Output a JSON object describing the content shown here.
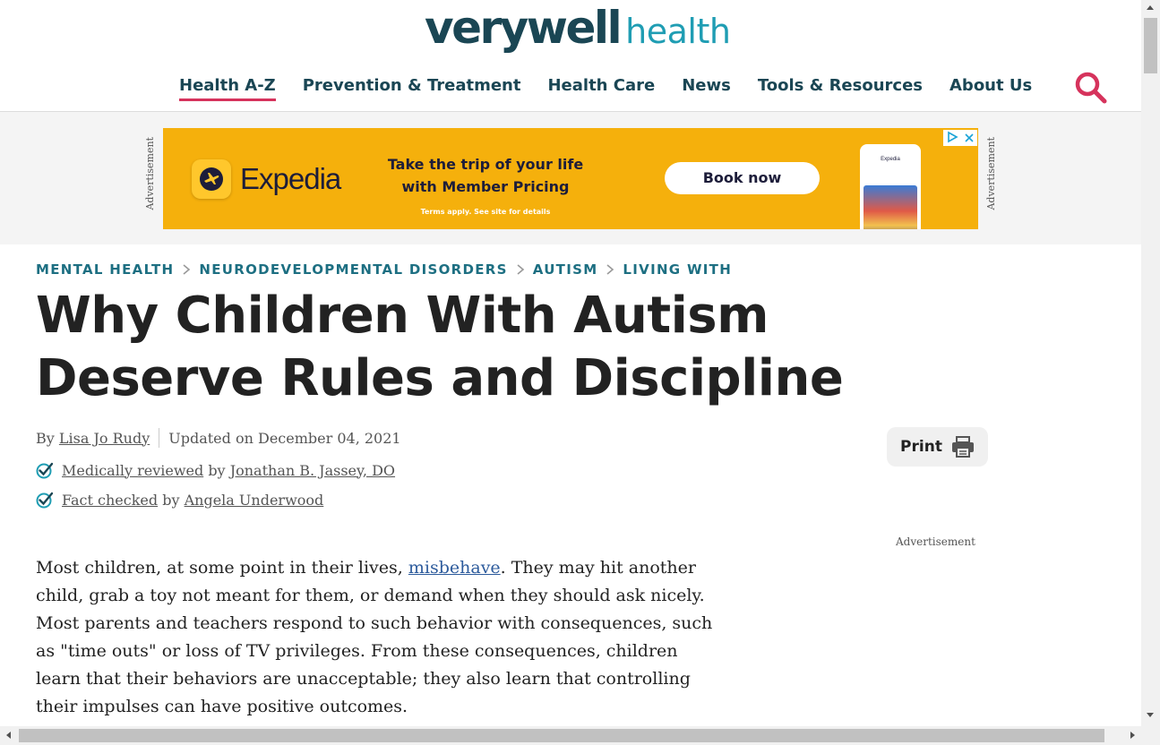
{
  "header": {
    "logo_main": "verywell",
    "logo_sub": "health",
    "nav": [
      "Health A-Z",
      "Prevention & Treatment",
      "Health Care",
      "News",
      "Tools & Resources",
      "About Us"
    ],
    "active_nav": "Health A-Z",
    "search_icon": "search-icon"
  },
  "ad": {
    "vertical_label": "Advertisement",
    "brand": "Expedia",
    "tagline_line1": "Take the trip of your life",
    "tagline_line2": "with Member Pricing",
    "terms": "Terms apply. See site for details",
    "cta": "Book now",
    "phone_brand": "Expedia",
    "colors": {
      "background": "#f5b00c",
      "text": "#1d1d3a"
    }
  },
  "breadcrumb": [
    "MENTAL HEALTH",
    "NEURODEVELOPMENTAL DISORDERS",
    "AUTISM",
    "LIVING WITH"
  ],
  "article": {
    "title": "Why Children With Autism Deserve Rules and Discipline",
    "by_prefix": "By",
    "author": "Lisa Jo Rudy",
    "updated": "Updated on December 04, 2021",
    "medically_reviewed": "Medically reviewed",
    "reviewer_by": "by",
    "reviewer": "Jonathan B. Jassey, DO",
    "fact_checked": "Fact checked",
    "checker_by": "by",
    "checker": "Angela Underwood",
    "print_label": "Print",
    "side_ad_label": "Advertisement",
    "body_before_link": "Most children, at some point in their lives, ",
    "body_link": "misbehave",
    "body_after_link": ". They may hit another child, grab a toy not meant for them, or demand when they should ask nicely. Most parents and teachers respond to such behavior with consequences, such as \"time outs\" or loss of TV privileges. From these consequences, children learn that their behaviors are unacceptable; they also learn that controlling their impulses can have positive outcomes."
  },
  "colors": {
    "brand_dark": "#1a4654",
    "brand_light": "#1f9db3",
    "accent": "#d6335c",
    "breadcrumb": "#1d6f82",
    "link": "#2d5b9c"
  }
}
